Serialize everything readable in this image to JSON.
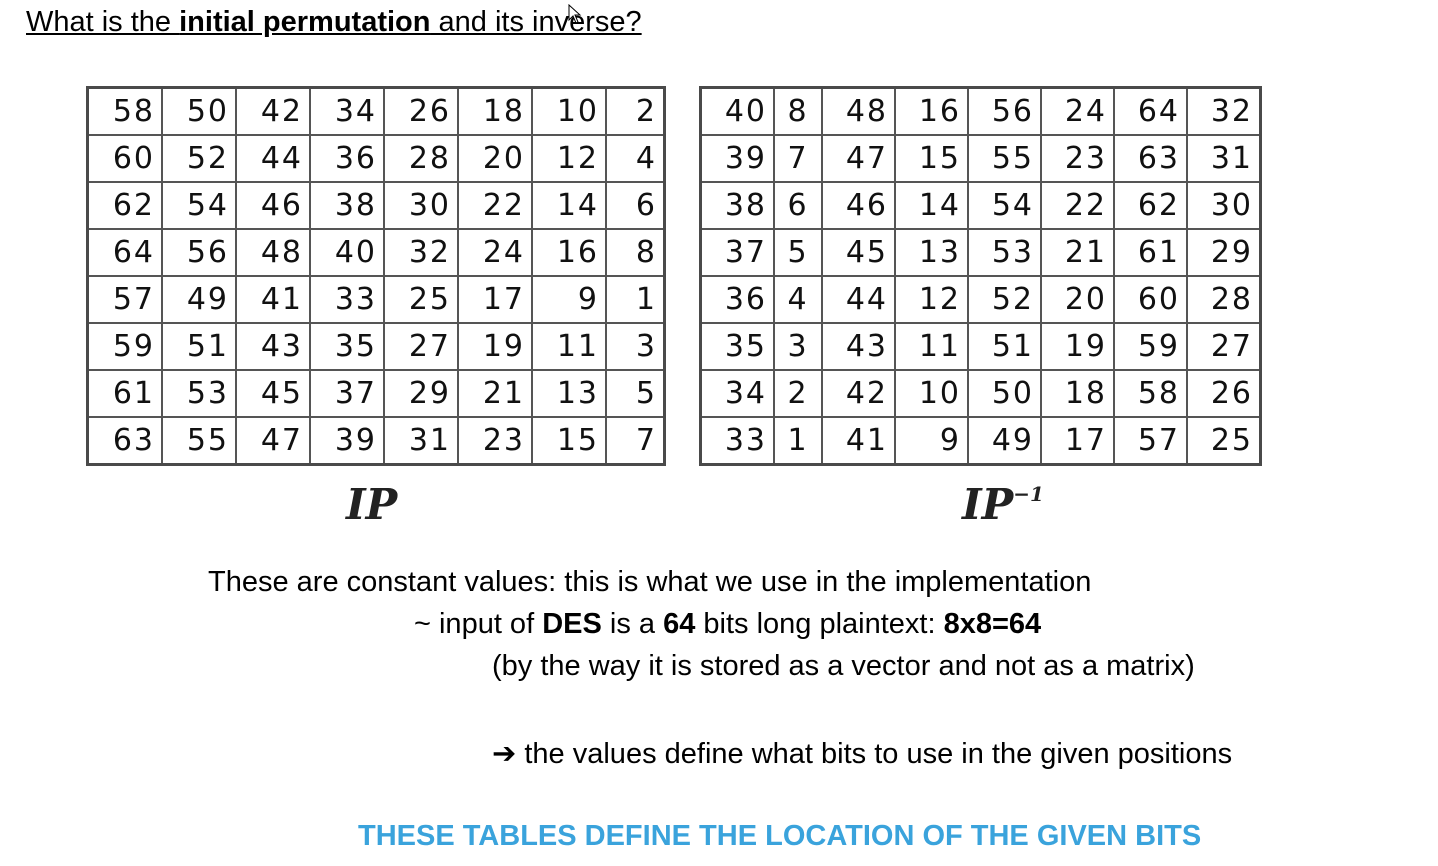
{
  "heading": {
    "prefix": "What is the ",
    "bold": "initial permutation",
    "suffix": " and its inverse?"
  },
  "tables": {
    "ip": {
      "caption": "IP",
      "rows": [
        [
          58,
          50,
          42,
          34,
          26,
          18,
          10,
          2
        ],
        [
          60,
          52,
          44,
          36,
          28,
          20,
          12,
          4
        ],
        [
          62,
          54,
          46,
          38,
          30,
          22,
          14,
          6
        ],
        [
          64,
          56,
          48,
          40,
          32,
          24,
          16,
          8
        ],
        [
          57,
          49,
          41,
          33,
          25,
          17,
          9,
          1
        ],
        [
          59,
          51,
          43,
          35,
          27,
          19,
          11,
          3
        ],
        [
          61,
          53,
          45,
          37,
          29,
          21,
          13,
          5
        ],
        [
          63,
          55,
          47,
          39,
          31,
          23,
          15,
          7
        ]
      ]
    },
    "ip_inverse": {
      "caption": "IP",
      "caption_sup": "−1",
      "rows": [
        [
          40,
          8,
          48,
          16,
          56,
          24,
          64,
          32
        ],
        [
          39,
          7,
          47,
          15,
          55,
          23,
          63,
          31
        ],
        [
          38,
          6,
          46,
          14,
          54,
          22,
          62,
          30
        ],
        [
          37,
          5,
          45,
          13,
          53,
          21,
          61,
          29
        ],
        [
          36,
          4,
          44,
          12,
          52,
          20,
          60,
          28
        ],
        [
          35,
          3,
          43,
          11,
          51,
          19,
          59,
          27
        ],
        [
          34,
          2,
          42,
          10,
          50,
          18,
          58,
          26
        ],
        [
          33,
          1,
          41,
          9,
          49,
          17,
          57,
          25
        ]
      ]
    }
  },
  "notes": {
    "line1": "These are constant values: this is what we use in the implementation",
    "line2": {
      "t1": "~ input of ",
      "b1": "DES",
      "t2": " is a ",
      "b2": "64",
      "t3": " bits long plaintext: ",
      "b3": "8x8=64"
    },
    "line3": "(by the way it is stored as a vector and not as a matrix)",
    "line4": {
      "arrow": "➔",
      "text": " the values define what bits to use in the given positions"
    },
    "footer": "THESE TABLES DEFINE THE LOCATION OF THE GIVEN BITS"
  },
  "colors": {
    "footer": "#3aa3dc",
    "table_border": "#4a4a4a"
  },
  "icons": [
    "mouse-cursor-icon"
  ]
}
